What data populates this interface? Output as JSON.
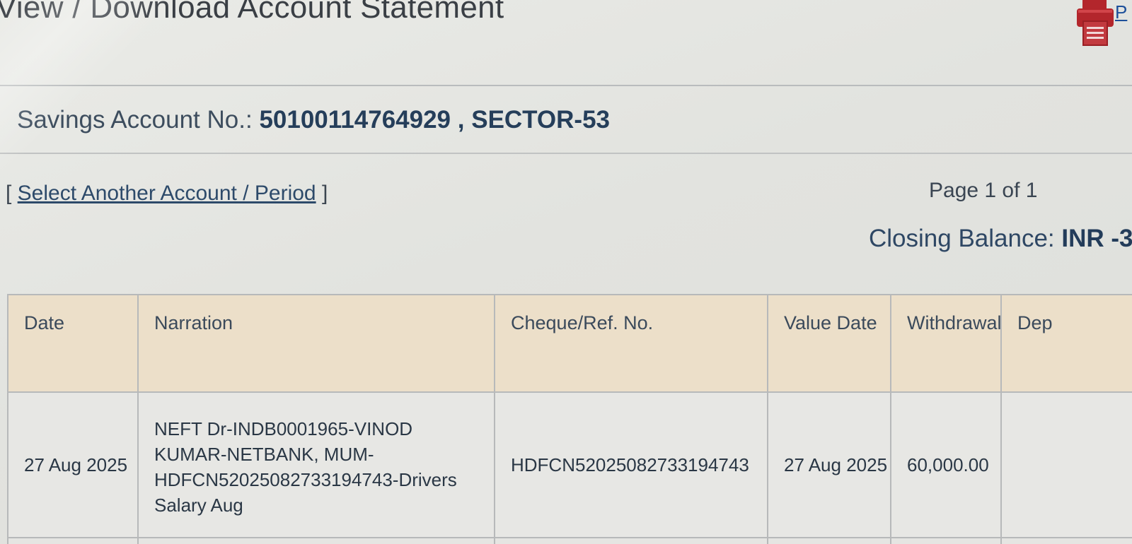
{
  "header": {
    "title": "View / Download Account Statement",
    "print_label": "P",
    "print_icon": "printer-icon"
  },
  "account": {
    "label": "Savings Account No.:",
    "number": "50100114764929",
    "separator": " , ",
    "branch": "SECTOR-53"
  },
  "controls": {
    "select_open": "[ ",
    "select_link": "Select Another Account / Period",
    "select_close": " ]",
    "page_info": "Page 1 of 1"
  },
  "balance": {
    "label": "Closing Balance: ",
    "amount": "INR -3"
  },
  "table": {
    "headers": [
      "Date",
      "Narration",
      "Cheque/Ref. No.",
      "Value Date",
      "Withdrawal",
      "Dep"
    ],
    "rows": [
      {
        "date": "27 Aug 2025",
        "narration_lines": [
          "NEFT Dr-INDB0001965-VINOD",
          "KUMAR-NETBANK, MUM-",
          "HDFCN52025082733194743-Drivers",
          "Salary Aug"
        ],
        "ref": "HDFCN52025082733194743",
        "value_date": "27 Aug 2025",
        "withdrawal": "60,000.00",
        "deposit": ""
      }
    ]
  },
  "colors": {
    "header_bg": "#ecdfc9",
    "text": "#2a3745",
    "link": "#2d4a6a",
    "printer_red": "#b3262c"
  }
}
